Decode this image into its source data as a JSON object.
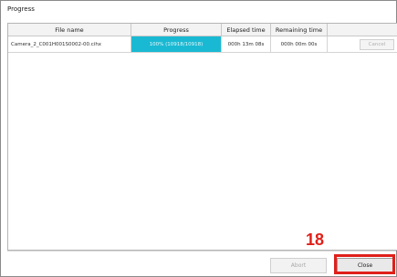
{
  "window": {
    "title": "Progress"
  },
  "table": {
    "columns": [
      "File name",
      "Progress",
      "Elapsed time",
      "Remaining time",
      ""
    ],
    "rows": [
      {
        "file_name": "Camera_2_C001H001S0002-00.cihx",
        "progress": "100% (10918/10918)",
        "progress_fraction": 1.0,
        "elapsed": "000h 13m 08s",
        "remaining": "000h 00m 00s",
        "action": "Cancel"
      }
    ]
  },
  "footer": {
    "abort_label": "Abort",
    "close_label": "Close"
  },
  "annotation": {
    "step_number": "18",
    "highlight_color": "#e0201a"
  },
  "colors": {
    "progress_fill": "#1ab9d3"
  }
}
